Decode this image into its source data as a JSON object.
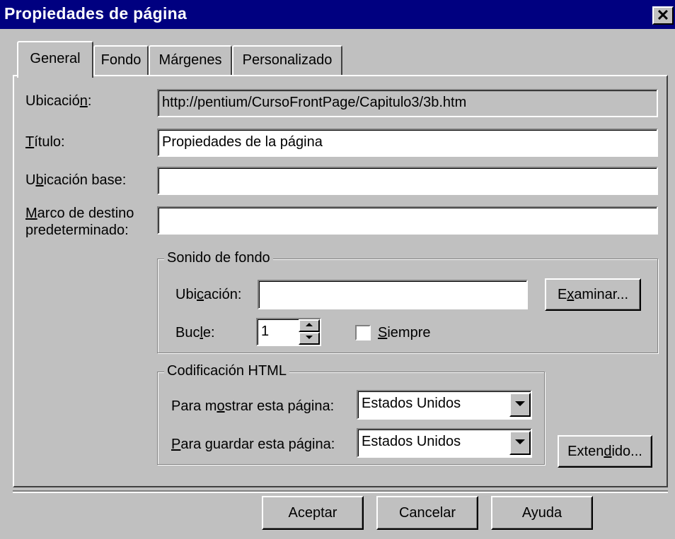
{
  "window": {
    "title": "Propiedades de página",
    "close_glyph": "✕"
  },
  "tabs": [
    {
      "label": "General",
      "active": true
    },
    {
      "label": "Fondo",
      "active": false
    },
    {
      "label": "Márgenes",
      "active": false
    },
    {
      "label": "Personalizado",
      "active": false
    }
  ],
  "general": {
    "ubicacion_label_pre": "Ubicació",
    "ubicacion_label_key": "n",
    "ubicacion_label_post": ":",
    "ubicacion_value": "http://pentium/CursoFrontPage/Capitulo3/3b.htm",
    "titulo_label_key": "T",
    "titulo_label_post": "ítulo:",
    "titulo_value": "Propiedades de la página",
    "base_label_pre": "U",
    "base_label_key": "b",
    "base_label_post": "icación base:",
    "base_value": "",
    "marco_label_key": "M",
    "marco_label_post": "arco de destino",
    "marco_label_line2": "predeterminado:",
    "marco_value": ""
  },
  "sonido": {
    "group_title": "Sonido de fondo",
    "ubicacion_label_pre": "Ubi",
    "ubicacion_label_key": "c",
    "ubicacion_label_post": "ación:",
    "ubicacion_value": "",
    "examinar_pre": "E",
    "examinar_key": "x",
    "examinar_post": "aminar...",
    "bucle_label_pre": "Buc",
    "bucle_label_key": "l",
    "bucle_label_post": "e:",
    "bucle_value": "1",
    "siempre_key": "S",
    "siempre_post": "iempre",
    "siempre_checked": false
  },
  "codificacion": {
    "group_title": "Codificación HTML",
    "mostrar_pre": "Para m",
    "mostrar_key": "o",
    "mostrar_post": "strar esta página:",
    "mostrar_value": "Estados Unidos",
    "guardar_key": "P",
    "guardar_post": "ara guardar esta página:",
    "guardar_value": "Estados Unidos",
    "extendido_pre": "Exten",
    "extendido_key": "d",
    "extendido_post": "ido..."
  },
  "footer": {
    "aceptar": "Aceptar",
    "cancelar": "Cancelar",
    "ayuda": "Ayuda"
  }
}
